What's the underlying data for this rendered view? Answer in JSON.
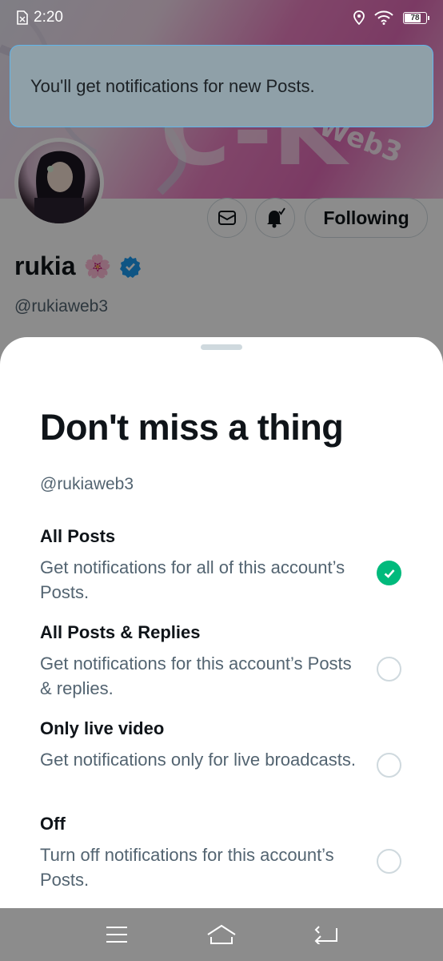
{
  "status_bar": {
    "time": "2:20",
    "battery": "78",
    "battery_level": 0.78
  },
  "toast": {
    "message": "You'll get notifications for new Posts."
  },
  "profile": {
    "name": "rukia",
    "name_emoji": "🌸",
    "handle": "@rukiaweb3",
    "banner_text": "Web3",
    "following_label": "Following"
  },
  "sheet": {
    "title": "Don't miss a thing",
    "handle": "@rukiaweb3",
    "options": [
      {
        "title": "All Posts",
        "desc": "Get notifications for all of this account’s Posts.",
        "selected": true
      },
      {
        "title": "All Posts & Replies",
        "desc": "Get notifications for this account’s Posts & replies.",
        "selected": false
      },
      {
        "title": "Only live video",
        "desc": "Get notifications only for live broadcasts.",
        "selected": false
      },
      {
        "title": "Off",
        "desc": "Turn off notifications for this account’s Posts.",
        "selected": false
      }
    ]
  },
  "colors": {
    "accent_green": "#00ba7c",
    "verified_blue": "#1d9bf0",
    "toast_border": "#5fb6ec"
  },
  "icons": {
    "nav": [
      "menu-icon",
      "home-icon",
      "back-icon"
    ]
  }
}
